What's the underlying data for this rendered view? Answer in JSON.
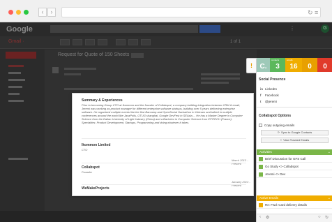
{
  "browser": {
    "back_icon": "chevron-left",
    "forward_icon": "chevron-right",
    "url_text": ""
  },
  "gmail": {
    "logo": "Google",
    "mail_label": "Gmail ·",
    "subject": "Request for Quote of 150 Sheets",
    "pager": "1 of 1",
    "footer_left": "",
    "footer_chat": "",
    "avatar_letter": "G"
  },
  "popup": {
    "section_title": "Summary & Experiences",
    "summary": "Prior to becoming Group CTO at Ikommon and the founder of Collabspot, a company building integration between CRM & email, Jeremi was working as product manager for different enterprise software startups, building over 5 years delivering enterprise software. He organised multiple events like the first Barcamp and OpenSocial Hackathon in Vietnam and talked in multiple conferences around the world like JavaPolis, GTUG shanghai, Google DevFest in SEAsia.... He has a Master Degree in Computer Science from the Dalian University of Light Industry (China) and a Bachelor in Computer Science from EPITECH (France). Specialties: Product Development, Startups, Programming and doing whatever it takes.",
    "experiences": [
      {
        "company": "Ikommon Limited",
        "role": "CTO",
        "date": "March 2013 - Present"
      },
      {
        "company": "Collabspot",
        "role": "Founder",
        "date": "January 2013 - Present"
      },
      {
        "company": "WeMakeProjects",
        "role": "",
        "date": ""
      }
    ]
  },
  "collabspot": {
    "tab_icon": "collabspot-logo",
    "tiles": [
      {
        "label": "",
        "value": "C.",
        "color": "#9ec9b8"
      },
      {
        "label": "contacts",
        "value": "3",
        "color": "#5cb85c"
      },
      {
        "label": "emails",
        "value": "16",
        "color": "#f0ad00"
      },
      {
        "label": "",
        "value": "0",
        "color": "#e8a000"
      },
      {
        "label": "",
        "value": "0",
        "color": "#e03a2b"
      }
    ],
    "social_title": "Social Presence",
    "social": [
      {
        "icon": "linkedin-icon",
        "glyph": "in",
        "label": "LinkedIn"
      },
      {
        "icon": "facebook-icon",
        "glyph": "f",
        "label": "Facebook"
      },
      {
        "icon": "twitter-icon",
        "glyph": "t",
        "label": "@jeremi"
      }
    ],
    "options_title": "Collabspot Options",
    "copy_label": "Copy outgoing emails",
    "sync_button": "Sync to Google Contacts",
    "view_button": "View Tracked Emails",
    "activities_title": "Activities",
    "activities": [
      {
        "label": "Brief Discussion for GFS Call",
        "color": "#7ab648"
      },
      {
        "label": "Go Study <> Collabspot",
        "color": "#7ab648"
      },
      {
        "label": "Jeremi <> Dev",
        "color": "#7ab648"
      }
    ],
    "emails_title": "Active Emails",
    "emails": [
      {
        "label": "Re: Fwd: Card delivery details",
        "color": "#f0ad00"
      }
    ]
  }
}
